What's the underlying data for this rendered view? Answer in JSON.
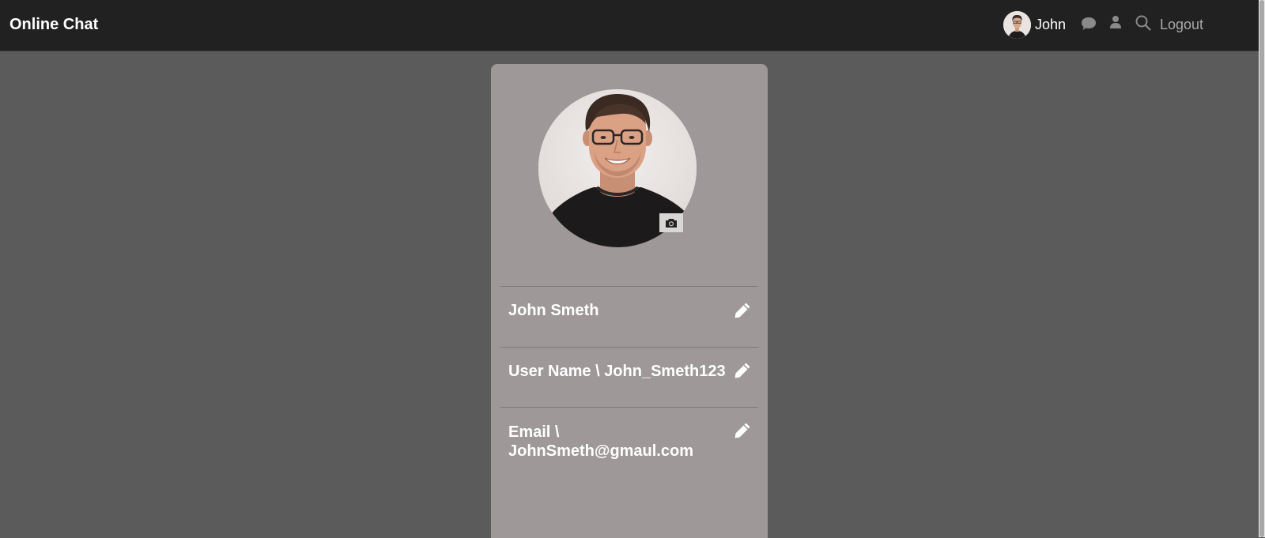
{
  "navbar": {
    "brand": "Online Chat",
    "user": {
      "name": "John"
    },
    "icons": [
      "chat-icon",
      "user-icon",
      "search-icon"
    ],
    "logout_label": "Logout"
  },
  "profile": {
    "full_name": "John Smeth",
    "username_label": "User Name",
    "username": "John_Smeth123",
    "email_label": "Email",
    "email": "JohnSmeth@gmaul.com",
    "separator": " \\ "
  },
  "colors": {
    "navbar_bg": "#212121",
    "page_bg": "#5b5b5b",
    "card_bg": "#9e9898",
    "logout_text": "#a9a9a9"
  }
}
